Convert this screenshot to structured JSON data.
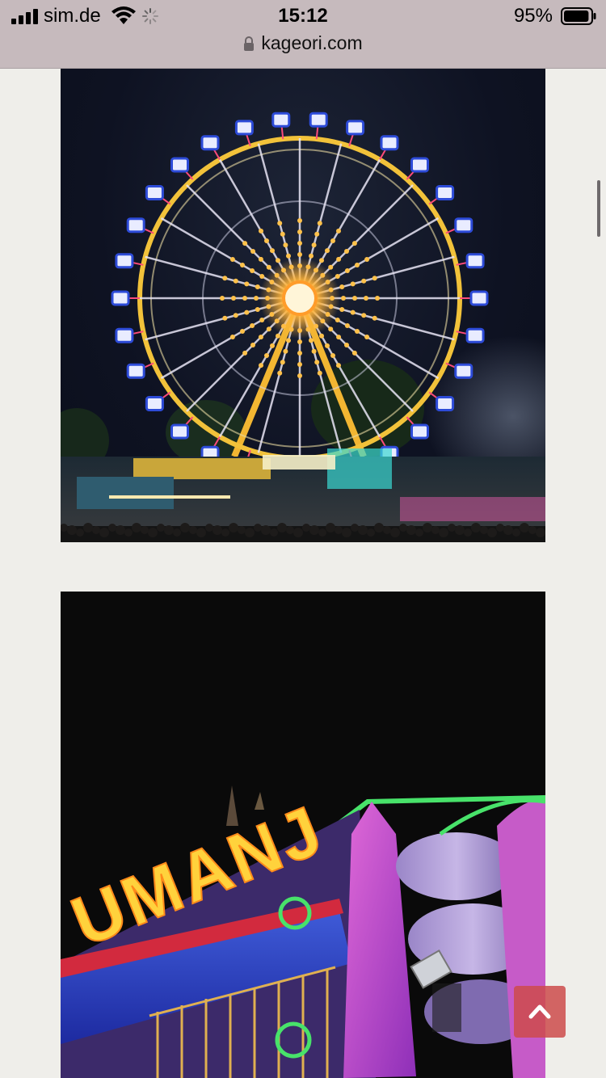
{
  "status_bar": {
    "carrier": "sim.de",
    "time": "15:12",
    "battery_percent": "95%",
    "battery_level": 0.95
  },
  "address_bar": {
    "url": "kageori.com"
  },
  "content": {
    "images": [
      {
        "subject": "ferris-wheel-night"
      },
      {
        "subject": "fun-house-ride-sign",
        "sign_text": "UMANJ"
      }
    ]
  },
  "colors": {
    "status_bar_bg": "#c6babd",
    "page_bg": "#efeeea",
    "back_to_top_bg": "#cd4b4b"
  },
  "icons": {
    "signal": "signal-bars-icon",
    "wifi": "wifi-icon",
    "loading": "activity-spinner-icon",
    "lock": "lock-icon",
    "battery": "battery-icon",
    "back_to_top": "chevron-up-icon"
  }
}
